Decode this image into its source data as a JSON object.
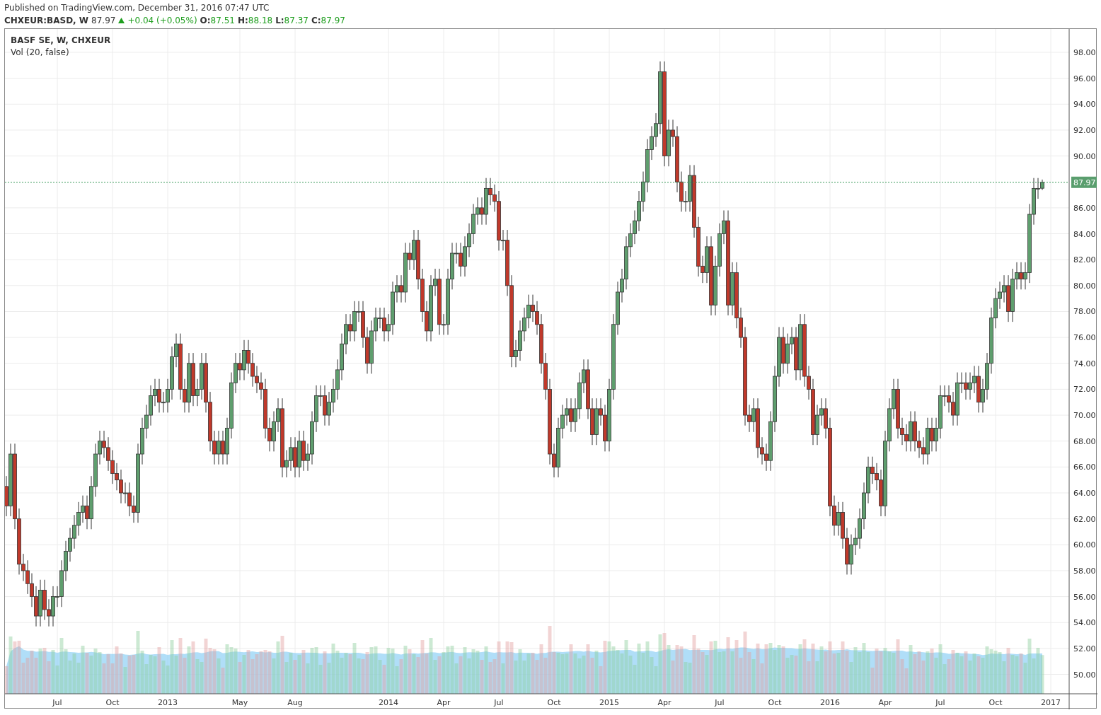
{
  "header": {
    "published": "Published on TradingView.com, December 31, 2016 07:47 UTC",
    "symbol": "CHXEUR:BASD, W",
    "last": "87.97",
    "change": "+0.04 (+0.05%)",
    "ohlc": [
      {
        "label": "O:",
        "value": "87.51"
      },
      {
        "label": "H:",
        "value": "88.18"
      },
      {
        "label": "L:",
        "value": "87.37"
      },
      {
        "label": "C:",
        "value": "87.97"
      }
    ]
  },
  "chart": {
    "legend": [
      "Vol (20, false)"
    ],
    "chart_data": {
      "type": "candlestick",
      "title": "BASF SE, W, CHXEUR",
      "grid": true,
      "ylim": [
        48.5,
        99.8
      ],
      "categories": [
        null,
        null,
        null,
        null,
        null,
        null,
        null,
        null,
        null,
        null,
        null,
        null,
        "Jul",
        null,
        null,
        null,
        null,
        null,
        null,
        null,
        null,
        null,
        null,
        null,
        null,
        "Oct",
        null,
        null,
        null,
        null,
        null,
        null,
        null,
        null,
        null,
        null,
        null,
        null,
        "2013",
        null,
        null,
        null,
        null,
        null,
        null,
        null,
        null,
        null,
        null,
        null,
        null,
        null,
        null,
        null,
        null,
        "May",
        null,
        null,
        null,
        null,
        null,
        null,
        null,
        null,
        null,
        null,
        null,
        null,
        "Aug",
        null,
        null,
        null,
        null,
        null,
        null,
        null,
        null,
        null,
        null,
        null,
        null,
        null,
        null,
        null,
        null,
        null,
        null,
        null,
        null,
        null,
        "2014",
        null,
        null,
        null,
        null,
        null,
        null,
        null,
        null,
        null,
        null,
        null,
        null,
        "Apr",
        null,
        null,
        null,
        null,
        null,
        null,
        null,
        null,
        null,
        null,
        null,
        null,
        "Jul",
        null,
        null,
        null,
        null,
        null,
        null,
        null,
        null,
        null,
        null,
        null,
        null,
        "Oct",
        null,
        null,
        null,
        null,
        null,
        null,
        null,
        null,
        null,
        null,
        null,
        null,
        "2015",
        null,
        null,
        null,
        null,
        null,
        null,
        null,
        null,
        null,
        null,
        null,
        null,
        "Apr",
        null,
        null,
        null,
        null,
        null,
        null,
        null,
        null,
        null,
        null,
        null,
        null,
        "Jul",
        null,
        null,
        null,
        null,
        null,
        null,
        null,
        null,
        null,
        null,
        null,
        null,
        "Oct",
        null,
        null,
        null,
        null,
        null,
        null,
        null,
        null,
        null,
        null,
        null,
        null,
        "2016",
        null,
        null,
        null,
        null,
        null,
        null,
        null,
        null,
        null,
        null,
        null,
        null,
        "Apr",
        null,
        null,
        null,
        null,
        null,
        null,
        null,
        null,
        null,
        null,
        null,
        null,
        "Jul",
        null,
        null,
        null,
        null,
        null,
        null,
        null,
        null,
        null,
        null,
        null,
        null,
        "Oct",
        null,
        null,
        null,
        null,
        null,
        null,
        null,
        null,
        null,
        null,
        null,
        null,
        "2017"
      ],
      "yticks": [
        {
          "value": 50,
          "label": "50.00"
        },
        {
          "value": 52,
          "label": "52.00"
        },
        {
          "value": 54,
          "label": "54.00"
        },
        {
          "value": 56,
          "label": "56.00"
        },
        {
          "value": 58,
          "label": "58.00"
        },
        {
          "value": 60,
          "label": "60.00"
        },
        {
          "value": 62,
          "label": "62.00"
        },
        {
          "value": 64,
          "label": "64.00"
        },
        {
          "value": 66,
          "label": "66.00"
        },
        {
          "value": 68,
          "label": "68.00"
        },
        {
          "value": 70,
          "label": "70.00"
        },
        {
          "value": 72,
          "label": "72.00"
        },
        {
          "value": 74,
          "label": "74.00"
        },
        {
          "value": 76,
          "label": "76.00"
        },
        {
          "value": 78,
          "label": "78.00"
        },
        {
          "value": 80,
          "label": "80.00"
        },
        {
          "value": 82,
          "label": "82.00"
        },
        {
          "value": 84,
          "label": "84.00"
        },
        {
          "value": 86,
          "label": "86.00"
        },
        {
          "value": 90,
          "label": "90.00"
        },
        {
          "value": 92,
          "label": "92.00"
        },
        {
          "value": 94,
          "label": "94.00"
        },
        {
          "value": 96,
          "label": "96.00"
        },
        {
          "value": 98,
          "label": "98.00"
        }
      ],
      "ref_lines": [
        {
          "axis": "y",
          "value": 87.97,
          "label": "87.97"
        }
      ],
      "ohlc": [
        [
          64.5,
          65.3,
          62.2,
          63
        ],
        [
          63,
          67.8,
          62.2,
          67
        ],
        [
          67,
          67.8,
          61.2,
          62
        ],
        [
          62,
          62.8,
          57.7,
          58.5
        ],
        [
          58.5,
          59.3,
          57.2,
          58
        ],
        [
          58,
          58.8,
          56.2,
          57
        ],
        [
          57,
          57.8,
          55.2,
          56
        ],
        [
          56,
          56.8,
          53.7,
          54.5
        ],
        [
          54.5,
          57.3,
          53.7,
          56.5
        ],
        [
          56.5,
          57.3,
          54.2,
          55
        ],
        [
          55,
          55.8,
          53.7,
          54.5
        ],
        [
          54.5,
          56.8,
          53.7,
          56
        ],
        [
          56,
          56.8,
          55.2,
          56
        ],
        [
          56,
          58.8,
          55.2,
          58
        ],
        [
          58,
          60.3,
          57.2,
          59.5
        ],
        [
          59.5,
          61.3,
          58.7,
          60.5
        ],
        [
          60.5,
          62.3,
          59.7,
          61.5
        ],
        [
          61.5,
          63.3,
          60.7,
          62.5
        ],
        [
          62.5,
          63.8,
          61.7,
          63
        ],
        [
          63,
          63.8,
          61.2,
          62
        ],
        [
          62,
          65.3,
          61.2,
          64.5
        ],
        [
          64.5,
          67.8,
          63.7,
          67
        ],
        [
          67,
          68.8,
          66.2,
          68
        ],
        [
          68,
          68.8,
          66.7,
          67.5
        ],
        [
          67.5,
          68.3,
          65.7,
          66.5
        ],
        [
          66.5,
          67.3,
          64.7,
          65.5
        ],
        [
          65.5,
          66.3,
          64.2,
          65
        ],
        [
          65,
          65.8,
          63.2,
          64
        ],
        [
          64,
          64.8,
          63.2,
          64
        ],
        [
          64,
          64.8,
          62.2,
          63
        ],
        [
          63,
          63.8,
          61.7,
          62.5
        ],
        [
          62.5,
          67.8,
          61.7,
          67
        ],
        [
          67,
          69.8,
          66.2,
          69
        ],
        [
          69,
          70.8,
          68.2,
          70
        ],
        [
          70,
          72.3,
          69.2,
          71.5
        ],
        [
          71.5,
          72.8,
          70.7,
          72
        ],
        [
          72,
          72.8,
          70.2,
          71
        ],
        [
          71,
          71.8,
          70.2,
          71
        ],
        [
          71,
          72.8,
          70.2,
          72
        ],
        [
          72,
          75.3,
          71.2,
          74.5
        ],
        [
          74.5,
          76.3,
          73.7,
          75.5
        ],
        [
          75.5,
          76.3,
          71.2,
          72
        ],
        [
          72,
          72.8,
          70.2,
          71
        ],
        [
          71,
          74.8,
          70.2,
          74
        ],
        [
          74,
          74.8,
          70.7,
          71.5
        ],
        [
          71.5,
          72.8,
          70.7,
          72
        ],
        [
          72,
          74.8,
          71.2,
          74
        ],
        [
          74,
          74.8,
          70.2,
          71
        ],
        [
          71,
          71.8,
          67.2,
          68
        ],
        [
          68,
          68.8,
          66.2,
          67
        ],
        [
          67,
          68.8,
          66.2,
          68
        ],
        [
          68,
          68.8,
          66.2,
          67
        ],
        [
          67,
          69.8,
          66.2,
          69
        ],
        [
          69,
          73.3,
          68.2,
          72.5
        ],
        [
          72.5,
          74.8,
          71.7,
          74
        ],
        [
          74,
          74.8,
          72.7,
          73.5
        ],
        [
          73.5,
          75.8,
          72.7,
          75
        ],
        [
          75,
          75.8,
          73.2,
          74
        ],
        [
          74,
          74.8,
          72.2,
          73
        ],
        [
          73,
          73.8,
          71.7,
          72.5
        ],
        [
          72.5,
          73.3,
          71.2,
          72
        ],
        [
          72,
          72.8,
          68.2,
          69
        ],
        [
          69,
          69.8,
          67.2,
          68
        ],
        [
          68,
          70.3,
          67.2,
          69.5
        ],
        [
          69.5,
          71.3,
          68.7,
          70.5
        ],
        [
          70.5,
          71.3,
          65.2,
          66
        ],
        [
          66,
          67.3,
          65.2,
          66.5
        ],
        [
          66.5,
          68.3,
          65.7,
          67.5
        ],
        [
          67.5,
          68.3,
          65.2,
          66
        ],
        [
          66,
          68.8,
          65.2,
          68
        ],
        [
          68,
          68.8,
          65.7,
          66.5
        ],
        [
          66.5,
          67.8,
          65.7,
          67
        ],
        [
          67,
          70.3,
          66.2,
          69.5
        ],
        [
          69.5,
          72.3,
          68.7,
          71.5
        ],
        [
          71.5,
          72.3,
          70.7,
          71.5
        ],
        [
          71.5,
          72.3,
          69.2,
          70
        ],
        [
          70,
          71.8,
          69.2,
          71
        ],
        [
          71,
          72.8,
          70.2,
          72
        ],
        [
          72,
          74.3,
          71.2,
          73.5
        ],
        [
          73.5,
          76.3,
          72.7,
          75.5
        ],
        [
          75.5,
          77.8,
          74.7,
          77
        ],
        [
          77,
          77.8,
          75.7,
          76.5
        ],
        [
          76.5,
          78.8,
          75.7,
          78
        ],
        [
          78,
          78.8,
          77.2,
          78
        ],
        [
          78,
          78.8,
          75.2,
          76
        ],
        [
          76,
          76.8,
          73.2,
          74
        ],
        [
          74,
          77.3,
          73.2,
          76.5
        ],
        [
          76.5,
          78.3,
          75.7,
          77.5
        ],
        [
          77.5,
          78.3,
          76.7,
          77.5
        ],
        [
          77.5,
          78.3,
          75.7,
          76.5
        ],
        [
          76.5,
          77.8,
          75.7,
          77
        ],
        [
          77,
          80.3,
          76.2,
          79.5
        ],
        [
          79.5,
          80.8,
          78.7,
          80
        ],
        [
          80,
          80.8,
          78.7,
          79.5
        ],
        [
          79.5,
          83.3,
          78.7,
          82.5
        ],
        [
          82.5,
          83.3,
          81.2,
          82
        ],
        [
          82,
          84.3,
          81.2,
          83.5
        ],
        [
          83.5,
          84.3,
          79.7,
          80.5
        ],
        [
          80.5,
          81.3,
          77.2,
          78
        ],
        [
          78,
          78.8,
          75.7,
          76.5
        ],
        [
          76.5,
          80.8,
          75.7,
          80
        ],
        [
          80,
          81.3,
          79.2,
          80.5
        ],
        [
          80.5,
          81.3,
          76.2,
          77
        ],
        [
          77,
          77.8,
          76.2,
          77
        ],
        [
          77,
          81.3,
          76.2,
          80.5
        ],
        [
          80.5,
          83.3,
          79.7,
          82.5
        ],
        [
          82.5,
          83.3,
          81.7,
          82.5
        ],
        [
          82.5,
          83.3,
          80.7,
          81.5
        ],
        [
          81.5,
          83.8,
          80.7,
          83
        ],
        [
          83,
          84.8,
          82.2,
          84
        ],
        [
          84,
          86.3,
          83.2,
          85.5
        ],
        [
          85.5,
          86.8,
          84.7,
          86
        ],
        [
          86,
          86.8,
          84.7,
          85.5
        ],
        [
          85.5,
          88.3,
          84.7,
          87.5
        ],
        [
          87.5,
          88.3,
          86.2,
          87
        ],
        [
          87,
          87.8,
          85.7,
          86.5
        ],
        [
          86.5,
          87.3,
          82.7,
          83.5
        ],
        [
          83.5,
          84.3,
          82.7,
          83.5
        ],
        [
          83.5,
          84.3,
          79.2,
          80
        ],
        [
          80,
          80.8,
          73.7,
          74.5
        ],
        [
          74.5,
          75.8,
          73.7,
          75
        ],
        [
          75,
          77.3,
          74.2,
          76.5
        ],
        [
          76.5,
          78.3,
          75.7,
          77.5
        ],
        [
          77.5,
          79.3,
          76.7,
          78.5
        ],
        [
          78.5,
          79.3,
          77.2,
          78
        ],
        [
          78,
          78.8,
          76.2,
          77
        ],
        [
          77,
          77.8,
          73.2,
          74
        ],
        [
          74,
          74.8,
          71.2,
          72
        ],
        [
          72,
          72.8,
          66.2,
          67
        ],
        [
          67,
          67.8,
          65.2,
          66
        ],
        [
          66,
          69.8,
          65.2,
          69
        ],
        [
          69,
          70.8,
          68.2,
          70
        ],
        [
          70,
          71.3,
          69.2,
          70.5
        ],
        [
          70.5,
          71.3,
          68.7,
          69.5
        ],
        [
          69.5,
          71.3,
          68.7,
          70.5
        ],
        [
          70.5,
          73.3,
          69.7,
          72.5
        ],
        [
          72.5,
          74.3,
          71.7,
          73.5
        ],
        [
          73.5,
          74.3,
          69.7,
          70.5
        ],
        [
          70.5,
          71.3,
          67.7,
          68.5
        ],
        [
          68.5,
          71.3,
          67.7,
          70.5
        ],
        [
          70.5,
          71.3,
          69.2,
          70
        ],
        [
          70,
          70.8,
          67.2,
          68
        ],
        [
          68,
          72.8,
          67.2,
          72
        ],
        [
          72,
          77.8,
          71.2,
          77
        ],
        [
          77,
          80.3,
          76.2,
          79.5
        ],
        [
          79.5,
          81.3,
          78.7,
          80.5
        ],
        [
          80.5,
          83.8,
          79.7,
          83
        ],
        [
          83,
          84.8,
          82.2,
          84
        ],
        [
          84,
          85.8,
          83.2,
          85
        ],
        [
          85,
          87.3,
          84.2,
          86.5
        ],
        [
          86.5,
          88.8,
          85.7,
          88
        ],
        [
          88,
          91.3,
          87.2,
          90.5
        ],
        [
          90.5,
          92.3,
          89.7,
          91.5
        ],
        [
          91.5,
          93.3,
          90.7,
          92.5
        ],
        [
          92.5,
          97.3,
          91.7,
          96.5
        ],
        [
          96.5,
          97.3,
          89.2,
          90
        ],
        [
          90,
          92.8,
          89.2,
          92
        ],
        [
          92,
          92.8,
          90.7,
          91.5
        ],
        [
          91.5,
          92.3,
          87.2,
          88
        ],
        [
          88,
          88.8,
          85.7,
          86.5
        ],
        [
          86.5,
          87.3,
          85.7,
          86.5
        ],
        [
          86.5,
          89.3,
          85.7,
          88.5
        ],
        [
          88.5,
          89.3,
          83.7,
          84.5
        ],
        [
          84.5,
          85.3,
          80.7,
          81.5
        ],
        [
          81.5,
          82.3,
          80.2,
          81
        ],
        [
          81,
          83.8,
          80.2,
          83
        ],
        [
          83,
          83.8,
          77.7,
          78.5
        ],
        [
          78.5,
          82.3,
          77.7,
          81.5
        ],
        [
          81.5,
          84.8,
          80.7,
          84
        ],
        [
          84,
          85.8,
          83.2,
          85
        ],
        [
          85,
          85.8,
          77.7,
          78.5
        ],
        [
          78.5,
          81.8,
          77.7,
          81
        ],
        [
          81,
          81.8,
          76.7,
          77.5
        ],
        [
          77.5,
          78.3,
          75.2,
          76
        ],
        [
          76,
          76.8,
          69.2,
          70
        ],
        [
          70,
          70.8,
          68.7,
          69.5
        ],
        [
          69.5,
          71.3,
          68.7,
          70.5
        ],
        [
          70.5,
          71.3,
          66.7,
          67.5
        ],
        [
          67.5,
          68.3,
          66.2,
          67
        ],
        [
          67,
          67.8,
          65.7,
          66.5
        ],
        [
          66.5,
          70.3,
          65.7,
          69.5
        ],
        [
          69.5,
          73.8,
          68.7,
          73
        ],
        [
          73,
          76.8,
          72.2,
          76
        ],
        [
          76,
          76.8,
          73.2,
          74
        ],
        [
          74,
          76.3,
          73.2,
          75.5
        ],
        [
          75.5,
          76.8,
          74.7,
          76
        ],
        [
          76,
          76.8,
          72.7,
          73.5
        ],
        [
          73.5,
          77.8,
          72.7,
          77
        ],
        [
          77,
          77.8,
          72.2,
          73
        ],
        [
          73,
          73.8,
          71.2,
          72
        ],
        [
          72,
          72.8,
          67.7,
          68.5
        ],
        [
          68.5,
          70.8,
          67.7,
          70
        ],
        [
          70,
          71.3,
          69.2,
          70.5
        ],
        [
          70.5,
          71.3,
          68.2,
          69
        ],
        [
          69,
          69.8,
          62.2,
          63
        ],
        [
          63,
          63.8,
          60.7,
          61.5
        ],
        [
          61.5,
          63.3,
          60.7,
          62.5
        ],
        [
          62.5,
          63.3,
          59.7,
          60.5
        ],
        [
          60.5,
          61.3,
          57.7,
          58.5
        ],
        [
          58.5,
          60.8,
          57.7,
          60
        ],
        [
          60,
          61.3,
          59.2,
          60.5
        ],
        [
          60.5,
          62.8,
          59.7,
          62
        ],
        [
          62,
          64.8,
          61.2,
          64
        ],
        [
          64,
          66.8,
          63.2,
          66
        ],
        [
          66,
          66.8,
          64.7,
          65.5
        ],
        [
          65.5,
          66.3,
          64.2,
          65
        ],
        [
          65,
          65.8,
          62.2,
          63
        ],
        [
          63,
          68.8,
          62.2,
          68
        ],
        [
          68,
          71.3,
          67.2,
          70.5
        ],
        [
          70.5,
          72.8,
          69.7,
          72
        ],
        [
          72,
          72.8,
          68.2,
          69
        ],
        [
          69,
          69.8,
          67.7,
          68.5
        ],
        [
          68.5,
          69.3,
          67.2,
          68
        ],
        [
          68,
          70.3,
          67.2,
          69.5
        ],
        [
          69.5,
          70.3,
          67.2,
          68
        ],
        [
          68,
          68.8,
          66.7,
          67.5
        ],
        [
          67.5,
          68.3,
          66.2,
          67
        ],
        [
          67,
          69.8,
          66.2,
          69
        ],
        [
          69,
          69.8,
          67.2,
          68
        ],
        [
          68,
          69.8,
          67.2,
          69
        ],
        [
          69,
          72.3,
          68.2,
          71.5
        ],
        [
          71.5,
          72.3,
          70.7,
          71.5
        ],
        [
          71.5,
          72.3,
          70.2,
          71
        ],
        [
          71,
          71.8,
          69.2,
          70
        ],
        [
          70,
          73.3,
          69.2,
          72.5
        ],
        [
          72.5,
          73.3,
          71.7,
          72.5
        ],
        [
          72.5,
          73.3,
          71.2,
          72
        ],
        [
          72,
          73.3,
          71.2,
          72.5
        ],
        [
          72.5,
          73.8,
          71.7,
          73
        ],
        [
          73,
          73.8,
          70.2,
          71
        ],
        [
          71,
          72.8,
          70.2,
          72
        ],
        [
          72,
          74.8,
          71.2,
          74
        ],
        [
          74,
          78.3,
          73.2,
          77.5
        ],
        [
          77.5,
          79.8,
          76.7,
          79
        ],
        [
          79,
          80.3,
          78.2,
          79.5
        ],
        [
          79.5,
          80.8,
          78.7,
          80
        ],
        [
          80,
          80.8,
          77.2,
          78
        ],
        [
          78,
          81.3,
          77.2,
          80.5
        ],
        [
          80.5,
          81.8,
          79.7,
          81
        ],
        [
          81,
          81.8,
          79.7,
          80.5
        ],
        [
          80.5,
          81.8,
          79.7,
          81
        ],
        [
          81,
          86.3,
          80.2,
          85.5
        ],
        [
          85.5,
          88.3,
          84.7,
          87.5
        ],
        [
          87.5,
          88.3,
          86.7,
          87.5
        ],
        [
          87.51,
          88.18,
          87.37,
          87.97
        ],
        null,
        null
      ]
    }
  }
}
